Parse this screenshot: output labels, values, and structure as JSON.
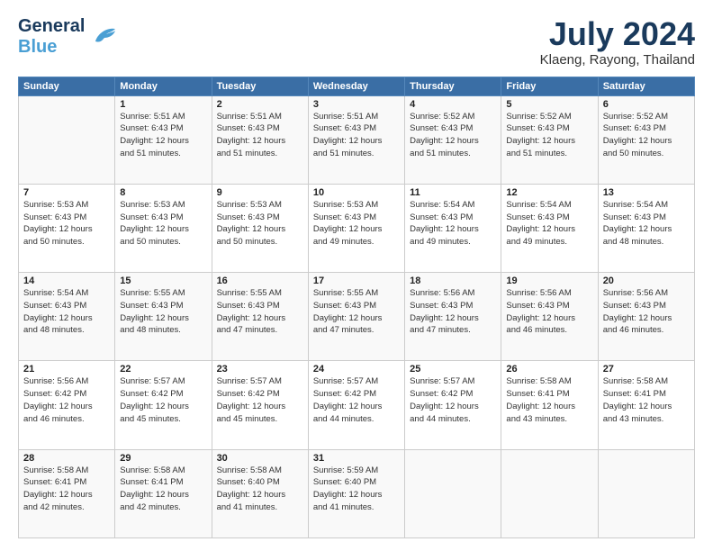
{
  "header": {
    "logo_general": "General",
    "logo_blue": "Blue",
    "month": "July 2024",
    "location": "Klaeng, Rayong, Thailand"
  },
  "weekdays": [
    "Sunday",
    "Monday",
    "Tuesday",
    "Wednesday",
    "Thursday",
    "Friday",
    "Saturday"
  ],
  "weeks": [
    [
      {
        "day": "",
        "info": ""
      },
      {
        "day": "1",
        "info": "Sunrise: 5:51 AM\nSunset: 6:43 PM\nDaylight: 12 hours\nand 51 minutes."
      },
      {
        "day": "2",
        "info": "Sunrise: 5:51 AM\nSunset: 6:43 PM\nDaylight: 12 hours\nand 51 minutes."
      },
      {
        "day": "3",
        "info": "Sunrise: 5:51 AM\nSunset: 6:43 PM\nDaylight: 12 hours\nand 51 minutes."
      },
      {
        "day": "4",
        "info": "Sunrise: 5:52 AM\nSunset: 6:43 PM\nDaylight: 12 hours\nand 51 minutes."
      },
      {
        "day": "5",
        "info": "Sunrise: 5:52 AM\nSunset: 6:43 PM\nDaylight: 12 hours\nand 51 minutes."
      },
      {
        "day": "6",
        "info": "Sunrise: 5:52 AM\nSunset: 6:43 PM\nDaylight: 12 hours\nand 50 minutes."
      }
    ],
    [
      {
        "day": "7",
        "info": "Sunrise: 5:53 AM\nSunset: 6:43 PM\nDaylight: 12 hours\nand 50 minutes."
      },
      {
        "day": "8",
        "info": "Sunrise: 5:53 AM\nSunset: 6:43 PM\nDaylight: 12 hours\nand 50 minutes."
      },
      {
        "day": "9",
        "info": "Sunrise: 5:53 AM\nSunset: 6:43 PM\nDaylight: 12 hours\nand 50 minutes."
      },
      {
        "day": "10",
        "info": "Sunrise: 5:53 AM\nSunset: 6:43 PM\nDaylight: 12 hours\nand 49 minutes."
      },
      {
        "day": "11",
        "info": "Sunrise: 5:54 AM\nSunset: 6:43 PM\nDaylight: 12 hours\nand 49 minutes."
      },
      {
        "day": "12",
        "info": "Sunrise: 5:54 AM\nSunset: 6:43 PM\nDaylight: 12 hours\nand 49 minutes."
      },
      {
        "day": "13",
        "info": "Sunrise: 5:54 AM\nSunset: 6:43 PM\nDaylight: 12 hours\nand 48 minutes."
      }
    ],
    [
      {
        "day": "14",
        "info": "Sunrise: 5:54 AM\nSunset: 6:43 PM\nDaylight: 12 hours\nand 48 minutes."
      },
      {
        "day": "15",
        "info": "Sunrise: 5:55 AM\nSunset: 6:43 PM\nDaylight: 12 hours\nand 48 minutes."
      },
      {
        "day": "16",
        "info": "Sunrise: 5:55 AM\nSunset: 6:43 PM\nDaylight: 12 hours\nand 47 minutes."
      },
      {
        "day": "17",
        "info": "Sunrise: 5:55 AM\nSunset: 6:43 PM\nDaylight: 12 hours\nand 47 minutes."
      },
      {
        "day": "18",
        "info": "Sunrise: 5:56 AM\nSunset: 6:43 PM\nDaylight: 12 hours\nand 47 minutes."
      },
      {
        "day": "19",
        "info": "Sunrise: 5:56 AM\nSunset: 6:43 PM\nDaylight: 12 hours\nand 46 minutes."
      },
      {
        "day": "20",
        "info": "Sunrise: 5:56 AM\nSunset: 6:43 PM\nDaylight: 12 hours\nand 46 minutes."
      }
    ],
    [
      {
        "day": "21",
        "info": "Sunrise: 5:56 AM\nSunset: 6:42 PM\nDaylight: 12 hours\nand 46 minutes."
      },
      {
        "day": "22",
        "info": "Sunrise: 5:57 AM\nSunset: 6:42 PM\nDaylight: 12 hours\nand 45 minutes."
      },
      {
        "day": "23",
        "info": "Sunrise: 5:57 AM\nSunset: 6:42 PM\nDaylight: 12 hours\nand 45 minutes."
      },
      {
        "day": "24",
        "info": "Sunrise: 5:57 AM\nSunset: 6:42 PM\nDaylight: 12 hours\nand 44 minutes."
      },
      {
        "day": "25",
        "info": "Sunrise: 5:57 AM\nSunset: 6:42 PM\nDaylight: 12 hours\nand 44 minutes."
      },
      {
        "day": "26",
        "info": "Sunrise: 5:58 AM\nSunset: 6:41 PM\nDaylight: 12 hours\nand 43 minutes."
      },
      {
        "day": "27",
        "info": "Sunrise: 5:58 AM\nSunset: 6:41 PM\nDaylight: 12 hours\nand 43 minutes."
      }
    ],
    [
      {
        "day": "28",
        "info": "Sunrise: 5:58 AM\nSunset: 6:41 PM\nDaylight: 12 hours\nand 42 minutes."
      },
      {
        "day": "29",
        "info": "Sunrise: 5:58 AM\nSunset: 6:41 PM\nDaylight: 12 hours\nand 42 minutes."
      },
      {
        "day": "30",
        "info": "Sunrise: 5:58 AM\nSunset: 6:40 PM\nDaylight: 12 hours\nand 41 minutes."
      },
      {
        "day": "31",
        "info": "Sunrise: 5:59 AM\nSunset: 6:40 PM\nDaylight: 12 hours\nand 41 minutes."
      },
      {
        "day": "",
        "info": ""
      },
      {
        "day": "",
        "info": ""
      },
      {
        "day": "",
        "info": ""
      }
    ]
  ]
}
